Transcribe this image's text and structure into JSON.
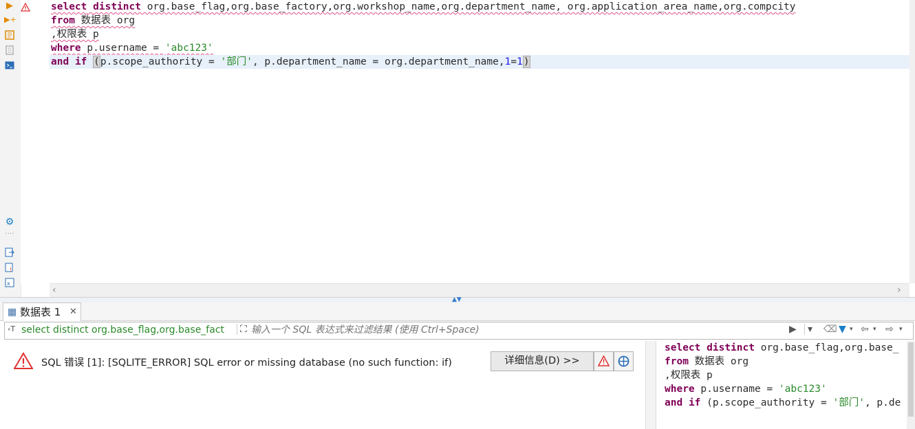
{
  "editor": {
    "lines": [
      {
        "segments": [
          {
            "t": "select",
            "c": "kw sq"
          },
          {
            "t": " ",
            "c": "sq"
          },
          {
            "t": "distinct",
            "c": "kw sq"
          },
          {
            "t": " org.base_flag,org.base_factory,org.workshop_name,org.department_name, org.application_area_name,org.compcity",
            "c": "sq"
          }
        ]
      },
      {
        "segments": [
          {
            "t": "from",
            "c": "kw sq"
          },
          {
            "t": " 数据表 org",
            "c": "sq"
          }
        ]
      },
      {
        "segments": [
          {
            "t": ",权限表 p",
            "c": "sq"
          }
        ]
      },
      {
        "segments": [
          {
            "t": "where",
            "c": "kw sq"
          },
          {
            "t": " p.username = ",
            "c": "sq"
          },
          {
            "t": "'abc123'",
            "c": "str sq"
          }
        ]
      },
      {
        "current": true,
        "segments": [
          {
            "t": "and",
            "c": "kw"
          },
          {
            "t": " ",
            "c": ""
          },
          {
            "t": "if",
            "c": "kw"
          },
          {
            "t": " ",
            "c": ""
          },
          {
            "t": "(",
            "c": "paren"
          },
          {
            "t": "p.scope_authority = ",
            "c": ""
          },
          {
            "t": "'部门'",
            "c": "str"
          },
          {
            "t": ", p.department_name = org.department_name,",
            "c": ""
          },
          {
            "t": "1",
            "c": "num"
          },
          {
            "t": "=",
            "c": ""
          },
          {
            "t": "1",
            "c": "num"
          },
          {
            "t": ")",
            "c": "paren"
          }
        ]
      }
    ]
  },
  "results_tab": {
    "label": "数据表 1"
  },
  "filter": {
    "query_text": "select distinct org.base_flag,org.base_fact",
    "placeholder": "输入一个 SQL 表达式来过滤结果 (使用 Ctrl+Space)"
  },
  "error": {
    "message": "SQL 错误 [1]: [SQLITE_ERROR] SQL error or missing database (no such function: if)",
    "details_button": "详细信息(D) >>"
  },
  "right_pane": {
    "lines": [
      {
        "segments": [
          {
            "t": "select",
            "c": "kw"
          },
          {
            "t": " ",
            "c": ""
          },
          {
            "t": "distinct",
            "c": "kw"
          },
          {
            "t": " org.base_flag,org.base_",
            "c": ""
          }
        ]
      },
      {
        "segments": [
          {
            "t": "from",
            "c": "kw"
          },
          {
            "t": " 数据表 org",
            "c": ""
          }
        ]
      },
      {
        "segments": [
          {
            "t": ",权限表 p",
            "c": ""
          }
        ]
      },
      {
        "segments": [
          {
            "t": "where",
            "c": "kw"
          },
          {
            "t": " p.username = ",
            "c": ""
          },
          {
            "t": "'abc123'",
            "c": "str"
          }
        ]
      },
      {
        "segments": [
          {
            "t": "and",
            "c": "kw"
          },
          {
            "t": " ",
            "c": ""
          },
          {
            "t": "if",
            "c": "kw"
          },
          {
            "t": " (p.scope_authority = ",
            "c": ""
          },
          {
            "t": "'部门'",
            "c": "str"
          },
          {
            "t": ", p.de",
            "c": ""
          }
        ]
      }
    ]
  },
  "colors": {
    "keyword": "#7f0055",
    "string": "#2a8a2a",
    "number": "#1a1ae6",
    "error": "#e03030",
    "current_line": "#e8f0fa"
  },
  "icons": [
    "run-statement-icon",
    "error-marker-icon",
    "run-script-icon",
    "explain-plan-icon",
    "load-script-icon",
    "console-icon",
    "settings-gear-icon",
    "export-icon",
    "import-icon",
    "table-grid-icon",
    "close-icon",
    "warning-triangle-icon",
    "target-icon",
    "filter-icon",
    "eraser-icon",
    "back-arrow-icon",
    "forward-arrow-icon",
    "expand-icon"
  ]
}
